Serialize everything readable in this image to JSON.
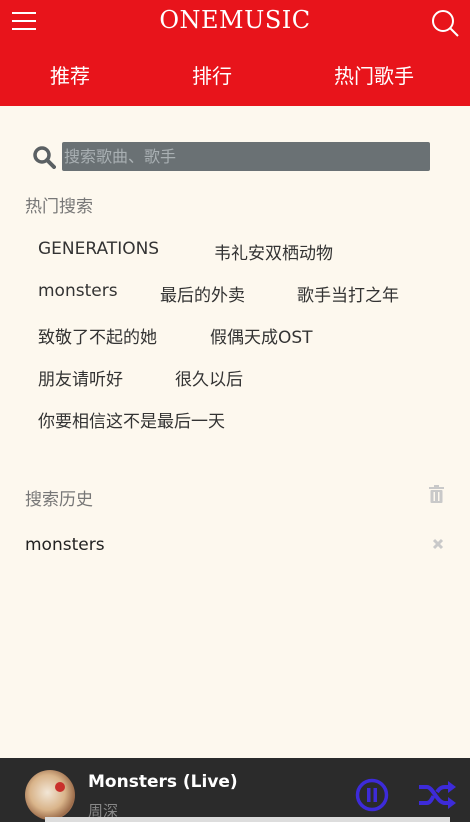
{
  "header": {
    "brand": "ONEMUSIC",
    "tabs": [
      {
        "label": "推荐"
      },
      {
        "label": "排行"
      },
      {
        "label": "热门歌手"
      }
    ]
  },
  "search": {
    "placeholder": "搜索歌曲、歌手",
    "value": ""
  },
  "hot": {
    "title": "热门搜索",
    "tags": [
      "GENERATIONS",
      "韦礼安双栖动物",
      "monsters",
      "最后的外卖",
      "歌手当打之年",
      "致敬了不起的她",
      "假偶天成OST",
      "朋友请听好",
      "很久以后",
      "你要相信这不是最后一天"
    ]
  },
  "history": {
    "title": "搜索历史",
    "items": [
      "monsters"
    ]
  },
  "player": {
    "title": "Monsters (Live)",
    "artist": "周深"
  },
  "colors": {
    "header_bg": "#e8141b",
    "page_bg": "#fdf8ee",
    "player_bg": "#2b2b2b",
    "control_accent": "#3d2bd9"
  },
  "icons": [
    "menu-icon",
    "search-icon",
    "trash-icon",
    "close-icon",
    "pause-icon",
    "shuffle-icon"
  ]
}
